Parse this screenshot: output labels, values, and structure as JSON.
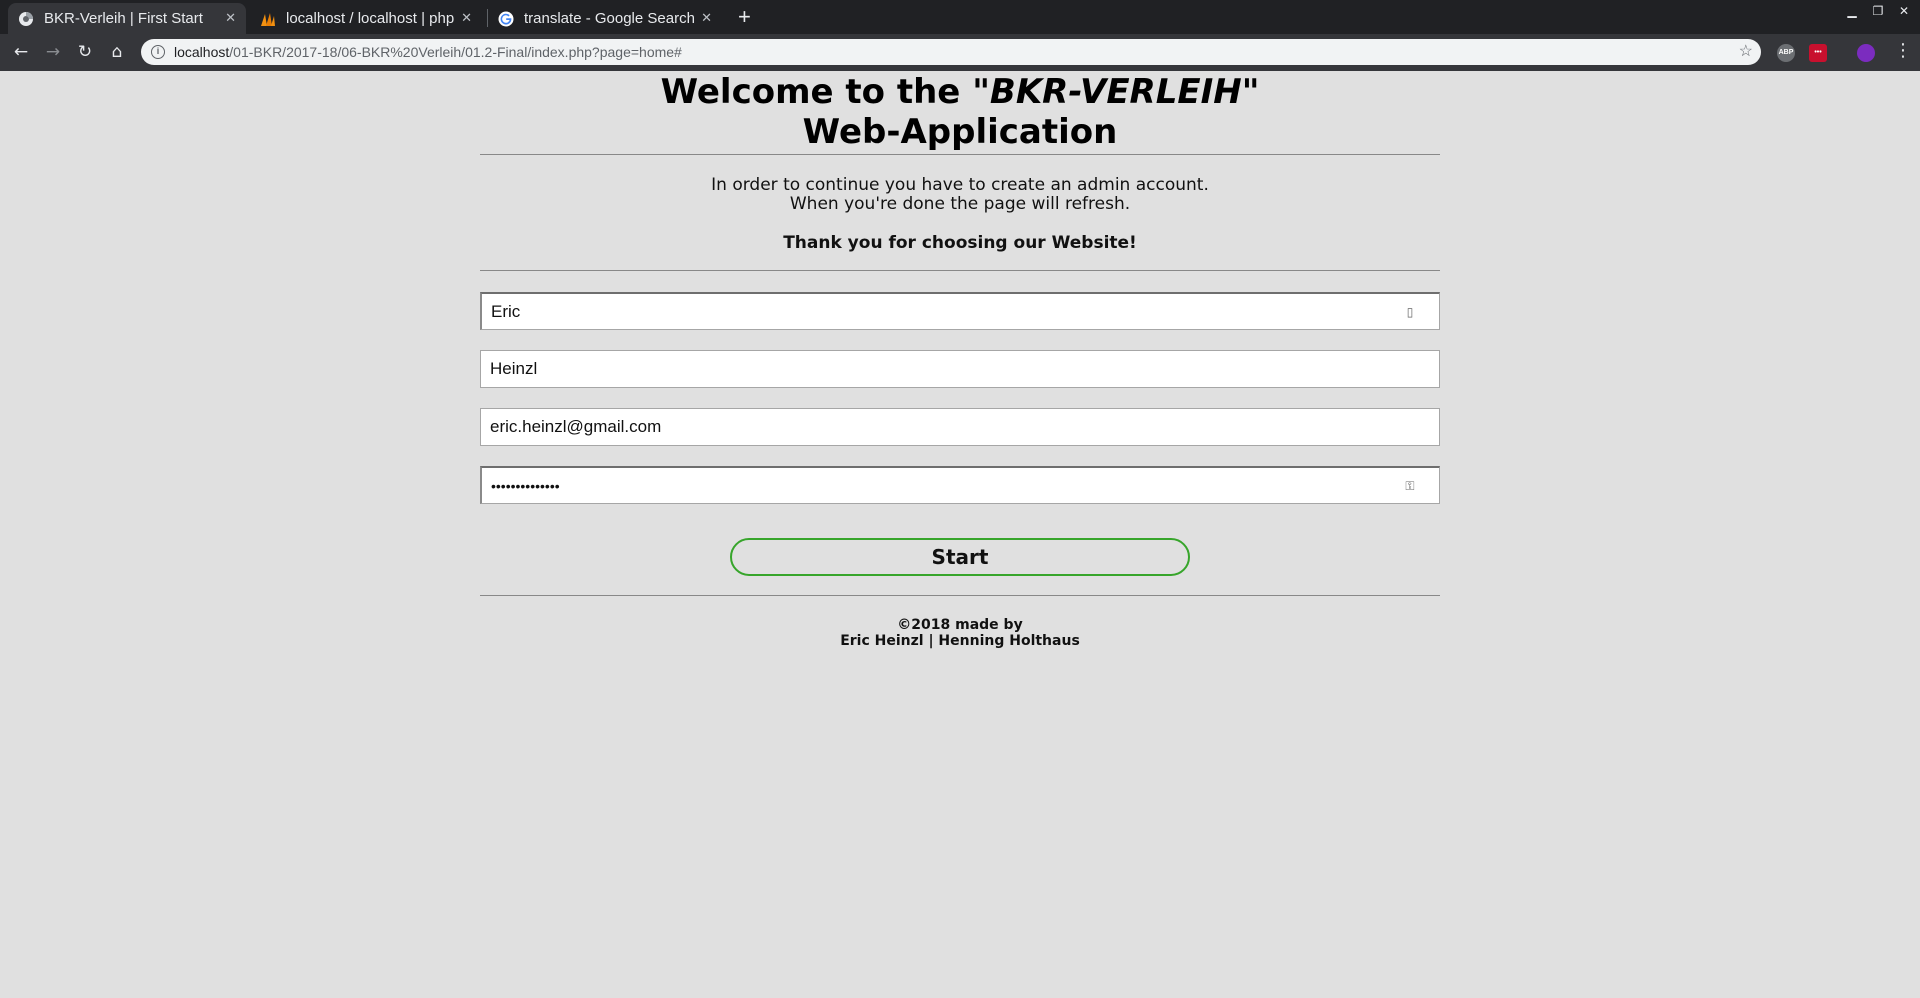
{
  "browser": {
    "tabs": [
      {
        "title": "BKR-Verleih | First Start",
        "favicon": "chrome-page-icon",
        "active": true
      },
      {
        "title": "localhost / localhost | php",
        "favicon": "phpmyadmin-icon",
        "active": false
      },
      {
        "title": "translate - Google Search",
        "favicon": "google-g-icon",
        "active": false
      }
    ],
    "new_tab": "+",
    "address": {
      "host": "localhost",
      "path": "/01-BKR/2017-18/06-BKR%20Verleih/01.2-Final/index.php?page=home#"
    },
    "extensions": [
      "ABP",
      "•••"
    ],
    "colors": {
      "tabbar": "#202124",
      "toolbar": "#35363a",
      "omnibox": "#f1f3f4"
    }
  },
  "page": {
    "title_prefix": "Welcome to the \"",
    "title_brand": "BKR-VERLEIH",
    "title_suffix": "\"",
    "title_line2": "Web-Application",
    "intro_line1": "In order to continue you have to create an admin account.",
    "intro_line2": "When you're done the page will refresh.",
    "thanks": "Thank you for choosing our Website!",
    "form": {
      "first_name": "Eric",
      "last_name": "Heinzl",
      "email": "eric.heinzl@gmail.com",
      "password": "••••••••••••••"
    },
    "start_label": "Start",
    "footer_line1": "©2018 made by",
    "footer_line2": "Eric Heinzl | Henning Holthaus",
    "colors": {
      "background": "#e0e0e0",
      "button_border": "#37a52b"
    }
  }
}
